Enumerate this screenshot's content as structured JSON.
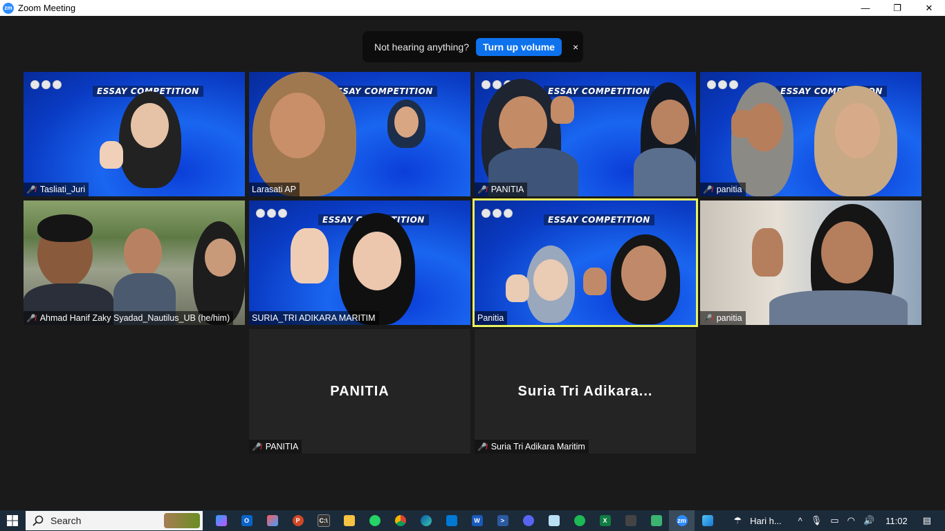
{
  "window": {
    "title": "Zoom Meeting",
    "minimize": "—",
    "restore": "❐",
    "close": "✕"
  },
  "notice": {
    "text": "Not hearing anything?",
    "button": "Turn up volume",
    "close": "×"
  },
  "banner": {
    "title": "ESSAY COMPETITION"
  },
  "tiles": [
    {
      "name": "Tasliati_Juri",
      "muted": true
    },
    {
      "name": "Larasati AP",
      "muted": false
    },
    {
      "name": "PANITIA",
      "muted": true
    },
    {
      "name": "panitia",
      "muted": true
    },
    {
      "name": "Ahmad Hanif Zaky Syadad_Nautilus_UB (he/him)",
      "muted": true
    },
    {
      "name": "SURIA_TRI ADIKARA MARITIM",
      "muted": false
    },
    {
      "name": "Panitia",
      "muted": false,
      "active_speaker": true
    },
    {
      "name": "panitia",
      "muted": true
    },
    {
      "name": "PANITIA",
      "muted": true,
      "display_name": "PANITIA",
      "video_off": true
    },
    {
      "name": "Suria Tri Adikara Maritim",
      "muted": true,
      "display_name": "Suria Tri Adikara...",
      "video_off": true
    }
  ],
  "taskbar": {
    "search_label": "Search",
    "weather_text": "Hari h...",
    "time": "11:02",
    "apps": [
      "copilot-icon",
      "outlook-icon",
      "teams-icon",
      "powerpoint-icon",
      "terminal-icon",
      "file-explorer-icon",
      "whatsapp-icon",
      "chrome-icon",
      "edge-icon",
      "vscode-icon",
      "word-icon",
      "powershell-icon",
      "discord-icon",
      "notepad-icon",
      "spotify-icon",
      "excel-icon",
      "terminal2-icon",
      "vs-icon",
      "zoom-icon",
      "photos-icon"
    ]
  },
  "colors": {
    "accent": "#0e72ed",
    "active_border": "#eaf560",
    "muted_red": "#e02828"
  }
}
